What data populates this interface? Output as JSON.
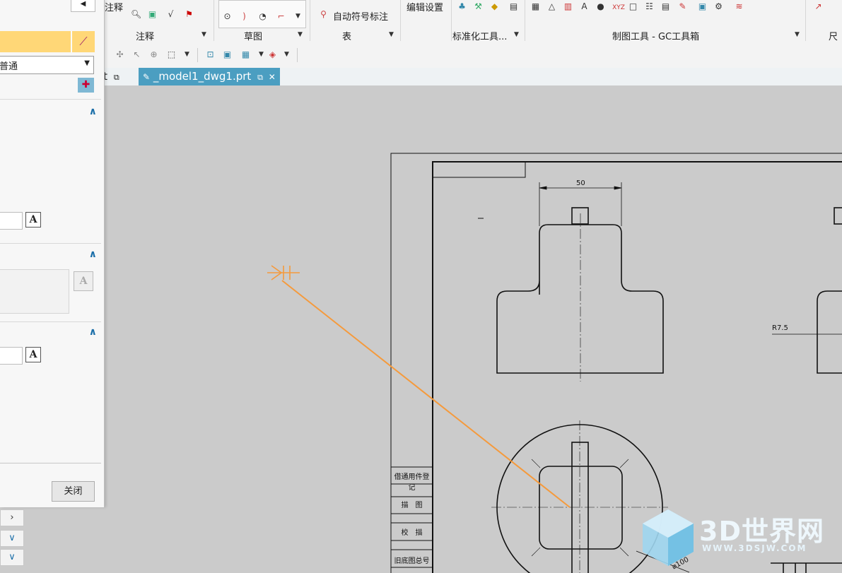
{
  "ribbon": {
    "annotation_label": "注释",
    "annotation_top": "注释",
    "sketch_label": "草图",
    "table_label": "表",
    "auto_symbol": "自动符号标注",
    "edit_settings": "编辑设置",
    "std_tools": "标准化工具...",
    "gc_toolbox": "制图工具 - GC工具箱",
    "dimension": "尺寸"
  },
  "tabs": {
    "prev": "rt",
    "active": "_model1_dwg1.prt"
  },
  "dialog": {
    "style_value": "普通",
    "close_label": "关闭"
  },
  "drawing": {
    "dim_width": "50",
    "dim_diameter": "⌀100",
    "dim_right": "R7.5",
    "table_rows": [
      "借通用件登记",
      "描　图",
      "校　描",
      "旧底图总号"
    ]
  },
  "watermark": {
    "brand": "3D世界网",
    "url": "WWW.3DSJW.COM"
  },
  "colors": {
    "accent": "#4b9ec1",
    "leader": "#f59a3c",
    "dialog_highlight": "#ffd777",
    "canvas": "#cbcbcb"
  }
}
